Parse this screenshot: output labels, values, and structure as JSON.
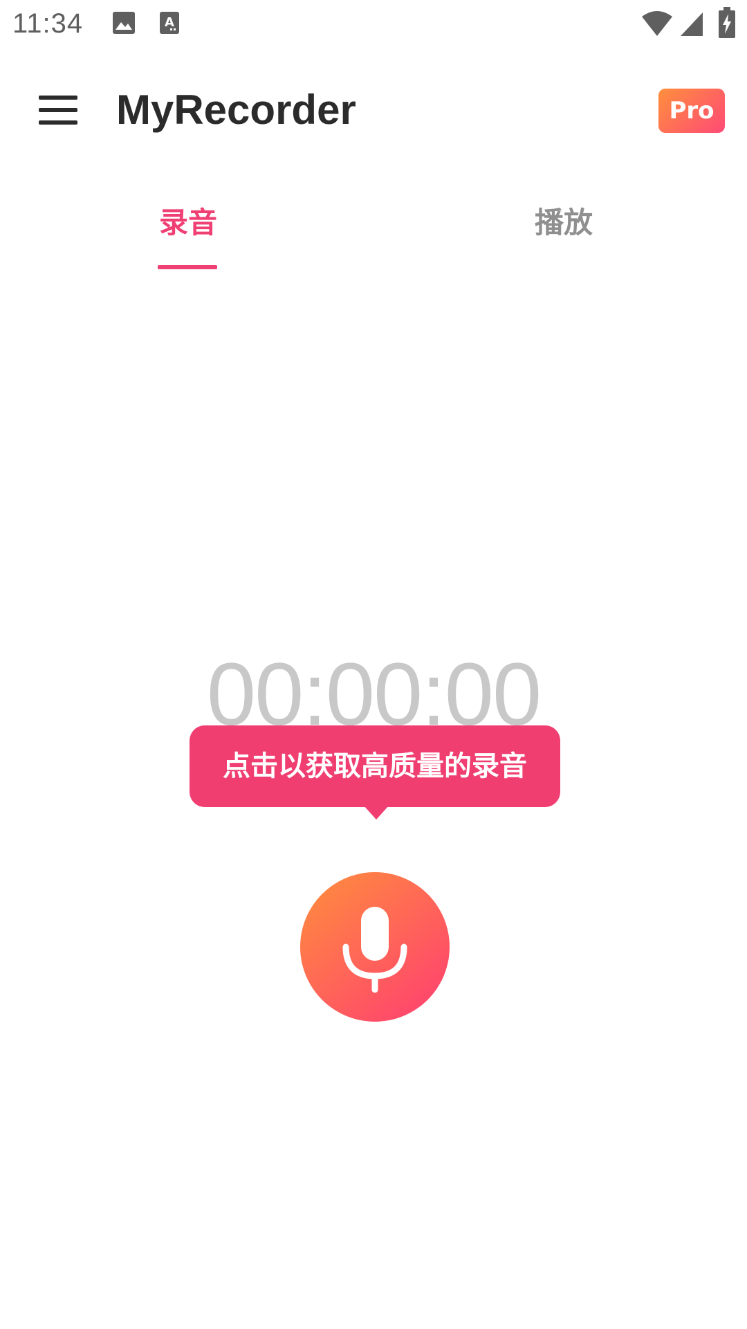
{
  "status_bar": {
    "time": "11:34",
    "icons": [
      "image-icon",
      "text-a-icon",
      "wifi-icon",
      "signal-icon",
      "battery-charging-icon"
    ]
  },
  "app_bar": {
    "title": "MyRecorder",
    "pro_label": "Pro",
    "menu_icon": "hamburger-menu-icon"
  },
  "tabs": [
    {
      "label": "录音",
      "selected": true
    },
    {
      "label": "播放",
      "selected": false
    }
  ],
  "recorder": {
    "timer": "00:00:00",
    "tooltip": "点击以获取高质量的录音",
    "button_icon": "microphone-icon"
  },
  "colors": {
    "accent": "#ef3f73",
    "gradient_start": "#ff8f3c",
    "gradient_end": "#ff3d72",
    "timer": "#c8c8c8",
    "inactive_tab": "#8f8f8f",
    "title": "#2b2b2b"
  }
}
